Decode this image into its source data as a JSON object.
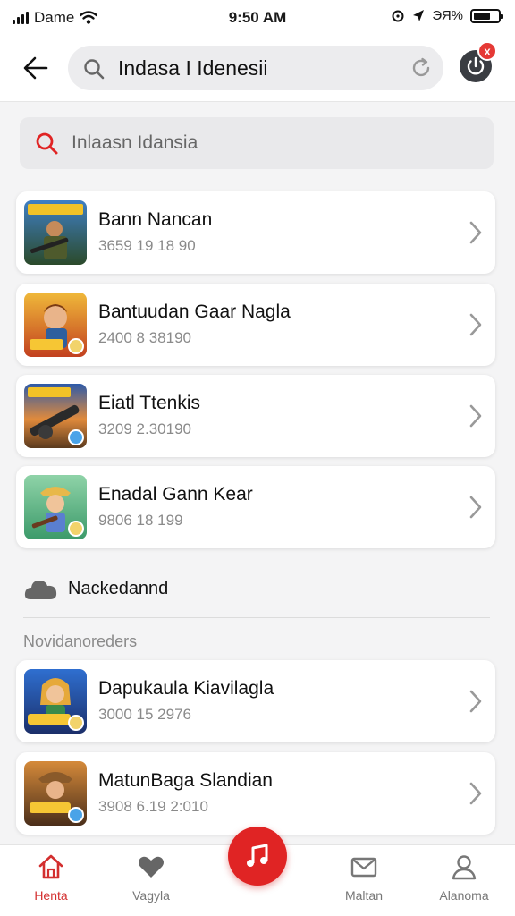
{
  "status_bar": {
    "carrier": "Dame",
    "time": "9:50 AM",
    "right_text": "ЭЯ%"
  },
  "header": {
    "search_text": "Indasa I Idenesii",
    "badge": "X"
  },
  "search": {
    "placeholder": "Inlaasn Idansia"
  },
  "results": [
    {
      "title": "Bann Nancan",
      "meta": "3659 19 18 90",
      "thumb": "soldier"
    },
    {
      "title": "Bantuudan Gaar Nagla",
      "meta": "2400 8 38190",
      "thumb": "kid-gunner"
    },
    {
      "title": "Eiatl Ttenkis",
      "meta": "3209 2.30190",
      "thumb": "cannon"
    },
    {
      "title": "Enadal Gann Kear",
      "meta": "9806 18 199",
      "thumb": "explorer"
    }
  ],
  "section": {
    "label": "Nackedannd",
    "icon": "cloud-icon",
    "subheading": "Novidanoreders"
  },
  "more_results": [
    {
      "title": "Dapukaula Kiavilagla",
      "meta": "3000 15 2976",
      "thumb": "heroine"
    },
    {
      "title": "MatunBaga Slandian",
      "meta": "3908 6.19 2:010",
      "thumb": "adventurer"
    }
  ],
  "bottom_nav": {
    "items": [
      {
        "label": "Henta",
        "icon": "home-icon",
        "active": true
      },
      {
        "label": "Vagyla",
        "icon": "heart-icon",
        "active": false
      },
      {
        "label": "Maltan",
        "icon": "mail-icon",
        "active": false
      },
      {
        "label": "Alanoma",
        "icon": "person-icon",
        "active": false
      }
    ],
    "center_icon": "music-note-icon"
  },
  "colors": {
    "accent": "#e02424",
    "background": "#f4f4f5",
    "card": "#ffffff",
    "muted_text": "#8a8a8a"
  }
}
